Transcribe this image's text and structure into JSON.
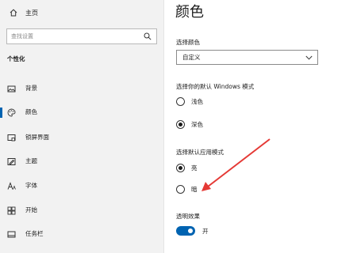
{
  "sidebar": {
    "home_label": "主页",
    "search_placeholder": "查找设置",
    "section_title": "个性化",
    "items": [
      {
        "label": "背景",
        "icon": "image-icon"
      },
      {
        "label": "颜色",
        "icon": "palette-icon",
        "active": true
      },
      {
        "label": "锁屏界面",
        "icon": "lock-screen-icon"
      },
      {
        "label": "主题",
        "icon": "theme-icon"
      },
      {
        "label": "字体",
        "icon": "font-icon"
      },
      {
        "label": "开始",
        "icon": "start-icon"
      },
      {
        "label": "任务栏",
        "icon": "taskbar-icon"
      }
    ]
  },
  "main": {
    "title": "颜色",
    "choose_color": {
      "label": "选择颜色",
      "value": "自定义"
    },
    "windows_mode": {
      "label": "选择你的默认 Windows 模式",
      "options": [
        {
          "label": "浅色",
          "checked": false
        },
        {
          "label": "深色",
          "checked": true
        }
      ]
    },
    "app_mode": {
      "label": "选择默认应用模式",
      "options": [
        {
          "label": "亮",
          "checked": true
        },
        {
          "label": "暗",
          "checked": false
        }
      ]
    },
    "transparency": {
      "label": "透明效果",
      "state": "开",
      "on": true
    }
  },
  "colors": {
    "accent": "#0063b1",
    "annotation_arrow": "#e53935"
  }
}
